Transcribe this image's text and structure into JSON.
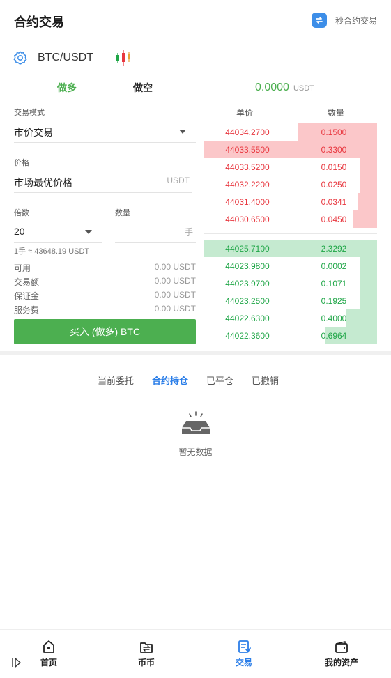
{
  "header": {
    "title": "合约交易",
    "switch_label": "秒合约交易"
  },
  "pair": {
    "name": "BTC/USDT"
  },
  "side_tabs": {
    "long": "做多",
    "short": "做空"
  },
  "form": {
    "mode_label": "交易模式",
    "mode_value": "市价交易",
    "price_label": "价格",
    "price_value": "市场最优价格",
    "price_unit": "USDT",
    "leverage_label": "倍数",
    "leverage_value": "20",
    "amount_label": "数量",
    "amount_unit": "手",
    "lot_hint": "1手 ≈ 43648.19 USDT",
    "info": [
      {
        "label": "可用",
        "value": "0.00 USDT"
      },
      {
        "label": "交易额",
        "value": "0.00 USDT"
      },
      {
        "label": "保证金",
        "value": "0.00 USDT"
      },
      {
        "label": "服务费",
        "value": "0.00 USDT"
      }
    ],
    "buy_button": "买入 (做多) BTC"
  },
  "orderbook": {
    "last_price": "0.0000",
    "last_price_unit": "USDT",
    "price_header": "单价",
    "qty_header": "数量",
    "asks": [
      {
        "price": "44034.2700",
        "qty": "0.1500",
        "depth": 0.46
      },
      {
        "price": "44033.5500",
        "qty": "0.3300",
        "depth": 1.0
      },
      {
        "price": "44033.5200",
        "qty": "0.0150",
        "depth": 0.1
      },
      {
        "price": "44032.2200",
        "qty": "0.0250",
        "depth": 0.1
      },
      {
        "price": "44031.4000",
        "qty": "0.0341",
        "depth": 0.11
      },
      {
        "price": "44030.6500",
        "qty": "0.0450",
        "depth": 0.14
      }
    ],
    "bids": [
      {
        "price": "44025.7100",
        "qty": "2.3292",
        "depth": 1.0
      },
      {
        "price": "44023.9800",
        "qty": "0.0002",
        "depth": 0.1
      },
      {
        "price": "44023.9700",
        "qty": "0.1071",
        "depth": 0.1
      },
      {
        "price": "44023.2500",
        "qty": "0.1925",
        "depth": 0.1
      },
      {
        "price": "44022.6300",
        "qty": "0.4000",
        "depth": 0.18
      },
      {
        "price": "44022.3600",
        "qty": "0.6964",
        "depth": 0.3
      }
    ],
    "ask_color": "#e8373f",
    "bid_color": "#1fa647"
  },
  "order_tabs": [
    {
      "label": "当前委托",
      "active": false
    },
    {
      "label": "合约持仓",
      "active": true
    },
    {
      "label": "已平仓",
      "active": false
    },
    {
      "label": "已撤销",
      "active": false
    }
  ],
  "empty_text": "暂无数据",
  "bottom_nav": [
    {
      "label": "首页",
      "icon": "home-icon"
    },
    {
      "label": "币币",
      "icon": "exchange-icon"
    },
    {
      "label": "交易",
      "icon": "trade-icon",
      "active": true
    },
    {
      "label": "我的资产",
      "icon": "wallet-icon"
    }
  ],
  "accent_color": "#2b7ee8",
  "buy_color": "#4caf50"
}
